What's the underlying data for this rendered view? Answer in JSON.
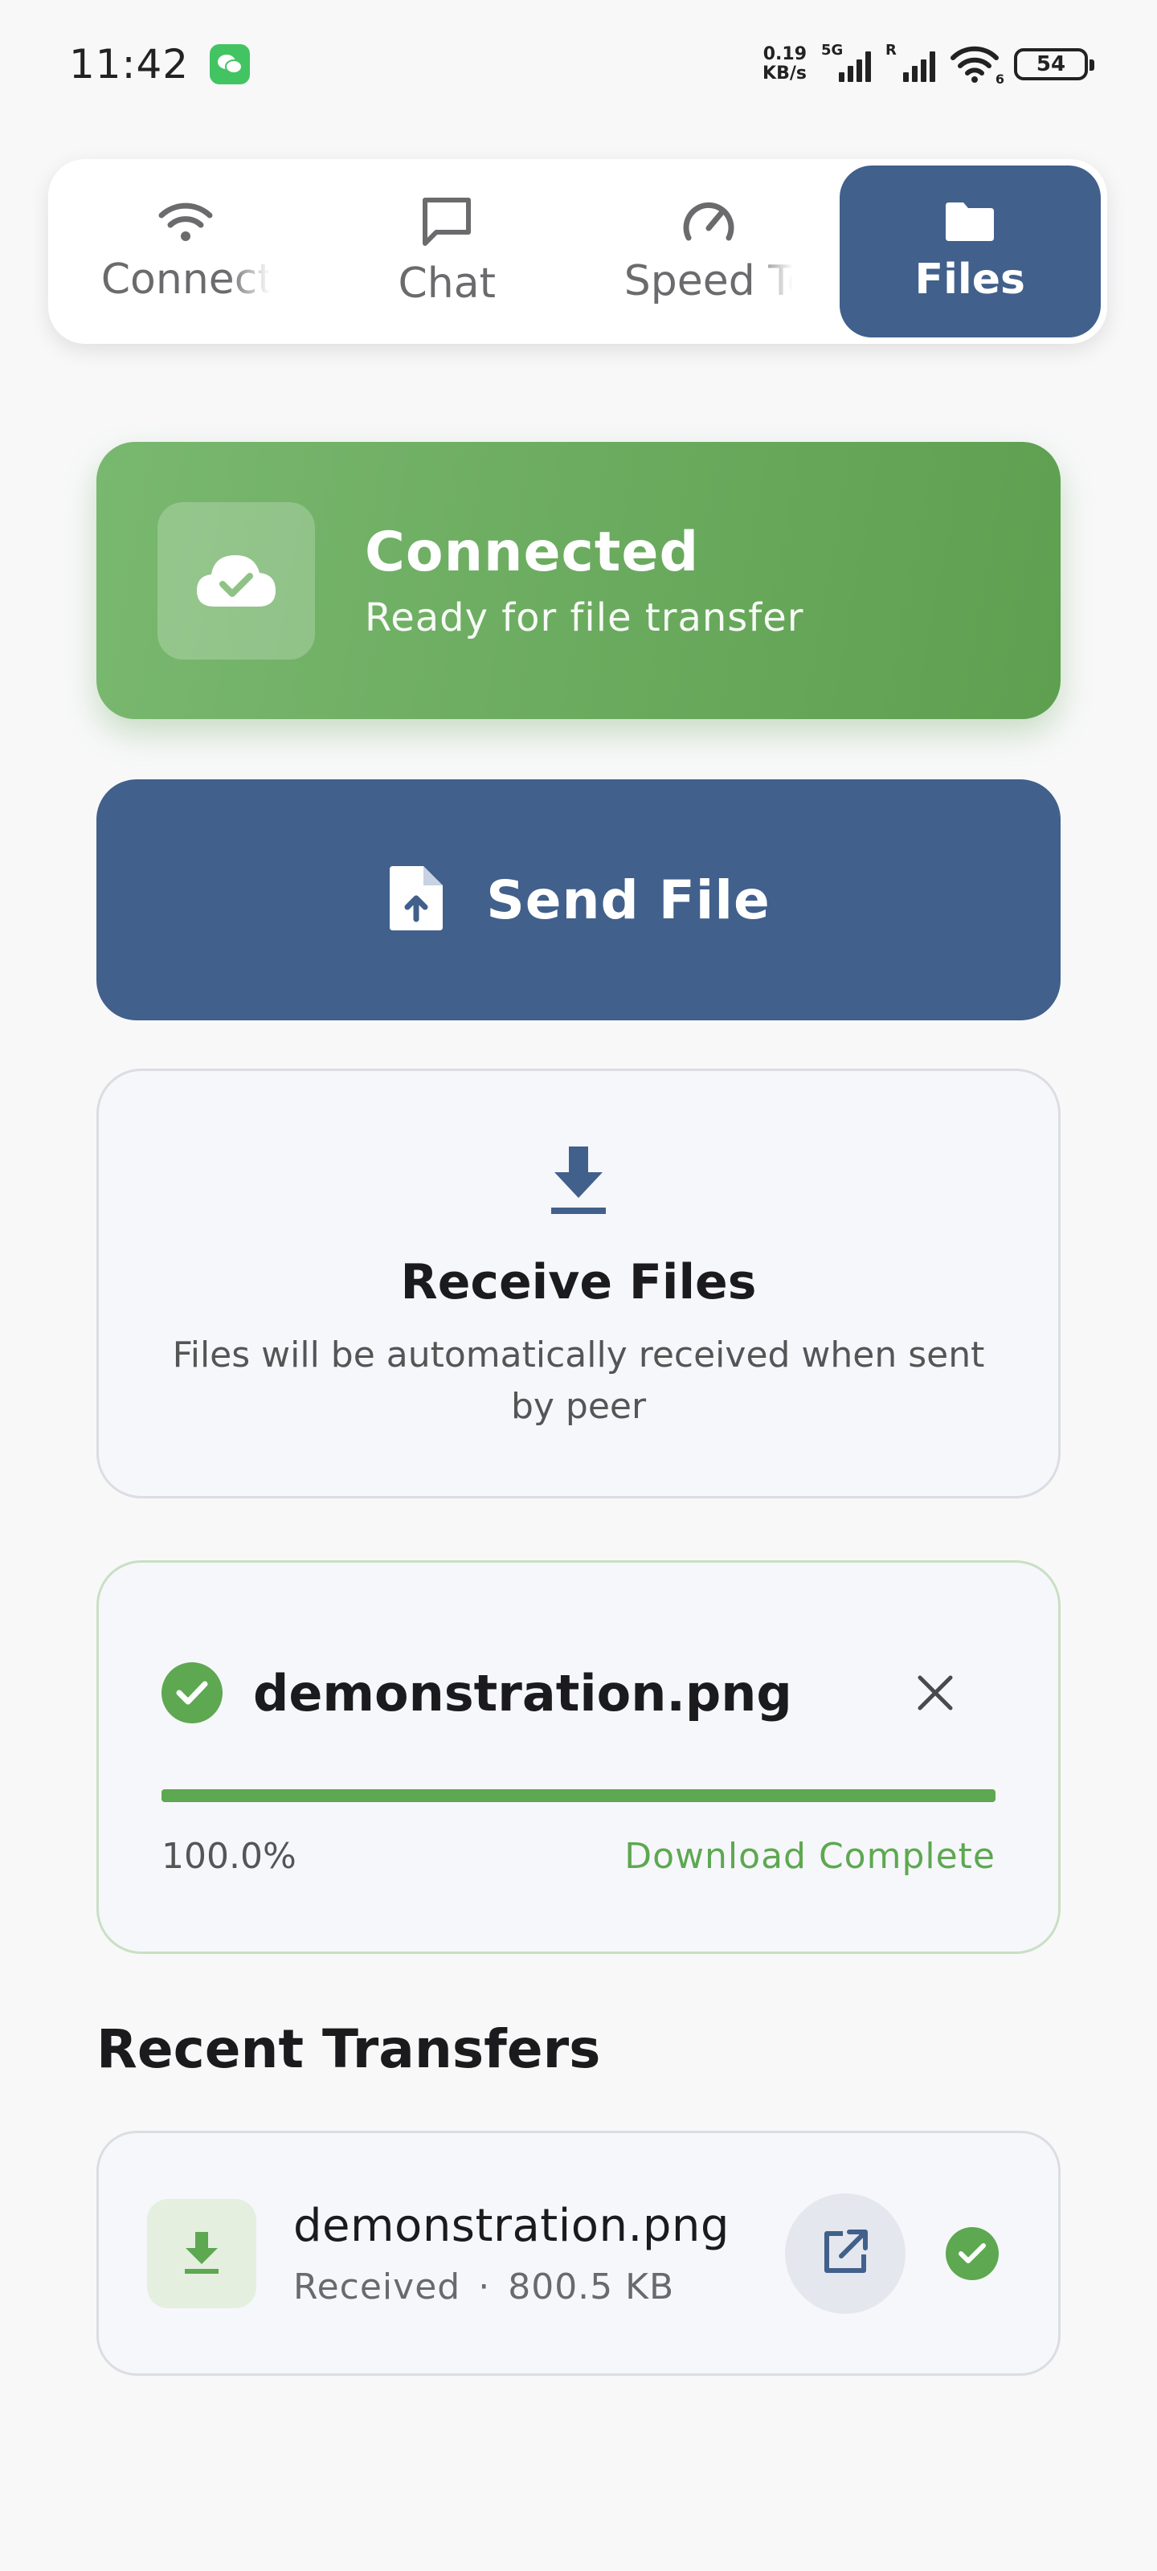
{
  "status_bar": {
    "time": "11:42",
    "net_speed_value": "0.19",
    "net_speed_unit": "KB/s",
    "network_tag": "5G",
    "roaming_tag": "R",
    "wifi_tag": "6",
    "battery": "54"
  },
  "tabs": [
    {
      "label": "Connect",
      "icon": "wifi-icon",
      "active": false
    },
    {
      "label": "Chat",
      "icon": "chat-icon",
      "active": false
    },
    {
      "label": "Speed Test",
      "icon": "speedometer-icon",
      "active": false
    },
    {
      "label": "Files",
      "icon": "folder-icon",
      "active": true
    }
  ],
  "connection": {
    "title": "Connected",
    "subtitle": "Ready for file transfer",
    "icon": "cloud-check-icon"
  },
  "send": {
    "label": "Send File",
    "icon": "file-upload-icon"
  },
  "receive": {
    "title": "Receive Files",
    "description": "Files will be automatically received when sent by peer",
    "icon": "download-icon"
  },
  "active_transfer": {
    "filename": "demonstration.png",
    "progress_text": "100.0%",
    "progress_fraction": 1.0,
    "status": "Download Complete"
  },
  "recent": {
    "title": "Recent Transfers",
    "items": [
      {
        "name": "demonstration.png",
        "direction": "Received",
        "separator": "·",
        "size": "800.5 KB"
      }
    ]
  },
  "colors": {
    "primary": "#41608b",
    "success": "#5da850",
    "background": "#f8f8f9"
  }
}
